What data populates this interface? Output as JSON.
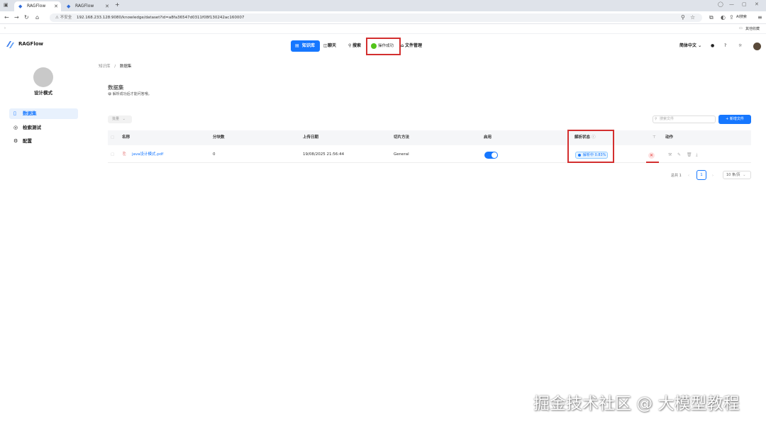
{
  "browser": {
    "tabs": [
      {
        "label": "RAGFlow",
        "active": true
      },
      {
        "label": "RAGFlow",
        "active": false
      }
    ],
    "new_tab": "+",
    "security_label": "不安全",
    "url": "192.168.233.128:9080/knowledge/dataset?id=a8fa36547d0311f08f130242ac160007",
    "ai_search": "AI搜索",
    "bookmarks_folder": "其他收藏"
  },
  "app": {
    "name": "RAGFlow",
    "nav": [
      {
        "label": "知识库",
        "icon": "database-icon",
        "active": true
      },
      {
        "label": "聊天",
        "icon": "chat-icon",
        "active": false
      },
      {
        "label": "搜索",
        "icon": "search-icon",
        "active": false
      },
      {
        "label": "文件管理",
        "icon": "file-icon",
        "active": false
      }
    ],
    "toast": "操作成功",
    "language": "简体中文"
  },
  "sidebar": {
    "kb_name": "设计模式",
    "items": [
      {
        "label": "数据集",
        "icon": "document-icon",
        "active": true
      },
      {
        "label": "检索测试",
        "icon": "target-icon",
        "active": false
      },
      {
        "label": "配置",
        "icon": "settings-icon",
        "active": false
      }
    ]
  },
  "main": {
    "breadcrumb": [
      "知识库",
      "数据集"
    ],
    "title": "数据集",
    "subtitle": "😀 解析成功后才能问答哦。",
    "bulk_button": "批量",
    "search_placeholder": "搜索文件",
    "new_file_button": "新增文件",
    "columns": [
      "名称",
      "分块数",
      "上传日期",
      "切片方法",
      "启用",
      "解析状态",
      "动作"
    ],
    "rows": [
      {
        "name": "java设计模式.pdf",
        "chunks": "0",
        "upload_date": "19/08/2025 21:56:44",
        "method": "General",
        "enabled": true,
        "status": "解析中 0.83%"
      }
    ],
    "pagination": {
      "total": "总共 1",
      "page": "1",
      "page_size": "10 条/页"
    }
  },
  "watermark": "掘金技术社区 @ 大模型教程",
  "colors": {
    "accent": "#1677ff",
    "highlight": "#d32f2f",
    "success": "#52c41a"
  }
}
